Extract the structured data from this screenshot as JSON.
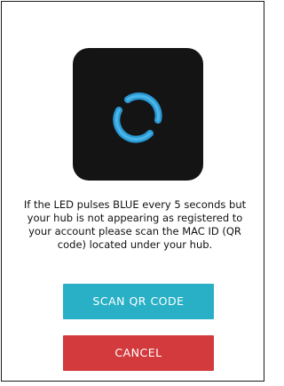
{
  "dialog": {
    "message": "If the LED pulses BLUE every 5 seconds but your hub is not appearing as registered to your account please scan the MAC ID (QR code) located under your hub.",
    "scan_button_label": "SCAN QR CODE",
    "cancel_button_label": "CANCEL"
  },
  "icons": {
    "hub": "hub-led-ring-icon"
  },
  "colors": {
    "hub_body": "#141414",
    "led_ring": "#2a9ad6",
    "scan_button": "#29b0c6",
    "cancel_button": "#d23a3e"
  }
}
